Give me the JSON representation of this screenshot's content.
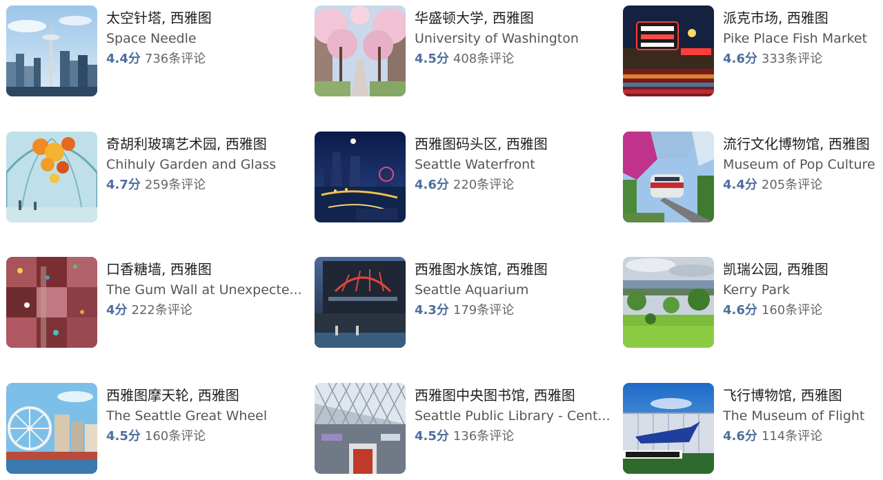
{
  "score_color": "#4e6e9e",
  "attractions": [
    {
      "title": "太空针塔, 西雅图",
      "subtitle": "Space Needle",
      "score": "4.4分",
      "reviews": "736条评论",
      "image": "space-needle-image"
    },
    {
      "title": "华盛顿大学, 西雅图",
      "subtitle": "University of Washington",
      "score": "4.5分",
      "reviews": "408条评论",
      "image": "cherry-blossom-image"
    },
    {
      "title": "派克市场, 西雅图",
      "subtitle": "Pike Place Fish Market",
      "score": "4.6分",
      "reviews": "333条评论",
      "image": "market-sign-image"
    },
    {
      "title": "奇胡利玻璃艺术园, 西雅图",
      "subtitle": "Chihuly Garden and Glass",
      "score": "4.7分",
      "reviews": "259条评论",
      "image": "glass-art-image"
    },
    {
      "title": "西雅图码头区, 西雅图",
      "subtitle": "Seattle Waterfront",
      "score": "4.6分",
      "reviews": "220条评论",
      "image": "waterfront-night-image"
    },
    {
      "title": "流行文化博物馆, 西雅图",
      "subtitle": "Museum of Pop Culture",
      "score": "4.4分",
      "reviews": "205条评论",
      "image": "monorail-museum-image"
    },
    {
      "title": "口香糖墙, 西雅图",
      "subtitle": "The Gum Wall at Unexpecte...",
      "score": "4分",
      "reviews": "222条评论",
      "image": "gum-wall-image"
    },
    {
      "title": "西雅图水族馆, 西雅图",
      "subtitle": "Seattle Aquarium",
      "score": "4.3分",
      "reviews": "179条评论",
      "image": "aquarium-image"
    },
    {
      "title": "凯瑞公园, 西雅图",
      "subtitle": "Kerry Park",
      "score": "4.6分",
      "reviews": "160条评论",
      "image": "park-view-image"
    },
    {
      "title": "西雅图摩天轮, 西雅图",
      "subtitle": "The Seattle Great Wheel",
      "score": "4.5分",
      "reviews": "160条评论",
      "image": "ferris-wheel-image"
    },
    {
      "title": "西雅图中央图书馆, 西雅图",
      "subtitle": "Seattle Public Library - Cent...",
      "score": "4.5分",
      "reviews": "136条评论",
      "image": "library-interior-image"
    },
    {
      "title": "飞行博物馆, 西雅图",
      "subtitle": "The Museum of Flight",
      "score": "4.6分",
      "reviews": "114条评论",
      "image": "flight-museum-image"
    }
  ]
}
